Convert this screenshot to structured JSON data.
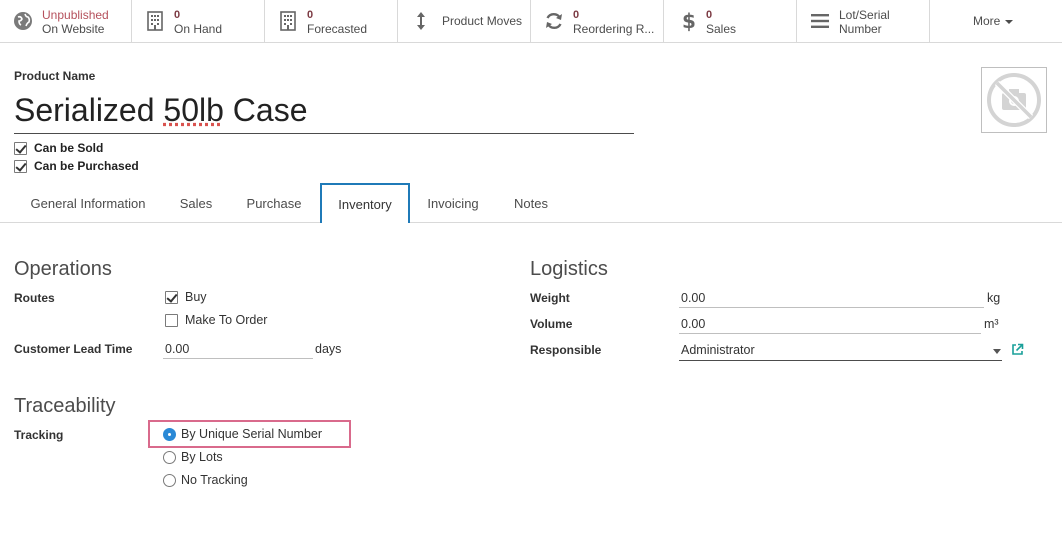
{
  "smart_buttons": [
    {
      "value": "Unpublished",
      "label": "On Website",
      "icon": "globe-icon"
    },
    {
      "value": "0",
      "label": "On Hand",
      "icon": "building-icon"
    },
    {
      "value": "0",
      "label": "Forecasted",
      "icon": "building-icon"
    },
    {
      "value": "",
      "label": "Product Moves",
      "icon": "arrows-vertical-icon"
    },
    {
      "value": "0",
      "label": "Reordering R...",
      "icon": "refresh-icon"
    },
    {
      "value": "0",
      "label": "Sales",
      "icon": "dollar-icon"
    },
    {
      "value": "Lot/Serial",
      "label": "Number",
      "icon": "list-icon"
    }
  ],
  "more_label": "More",
  "product_name_label": "Product Name",
  "product_name_part1": "Serialized ",
  "product_name_part2": "50lb",
  "product_name_part3": " Case",
  "can_be_sold": "Can be Sold",
  "can_be_purchased": "Can be Purchased",
  "tabs": [
    "General Information",
    "Sales",
    "Purchase",
    "Inventory",
    "Invoicing",
    "Notes"
  ],
  "operations": {
    "title": "Operations",
    "routes_label": "Routes",
    "route_buy": "Buy",
    "route_mto": "Make To Order",
    "lead_time_label": "Customer Lead Time",
    "lead_time_value": "0.00",
    "lead_time_unit": "days"
  },
  "logistics": {
    "title": "Logistics",
    "weight_label": "Weight",
    "weight_value": "0.00",
    "weight_unit": "kg",
    "volume_label": "Volume",
    "volume_value": "0.00",
    "volume_unit": "m³",
    "responsible_label": "Responsible",
    "responsible_value": "Administrator"
  },
  "traceability": {
    "title": "Traceability",
    "tracking_label": "Tracking",
    "options": [
      "By Unique Serial Number",
      "By Lots",
      "No Tracking"
    ],
    "selected": "By Unique Serial Number"
  },
  "colors": {
    "accent": "#1f7ab8",
    "highlight": "#d96a8c",
    "unpublished": "#b5505c"
  }
}
